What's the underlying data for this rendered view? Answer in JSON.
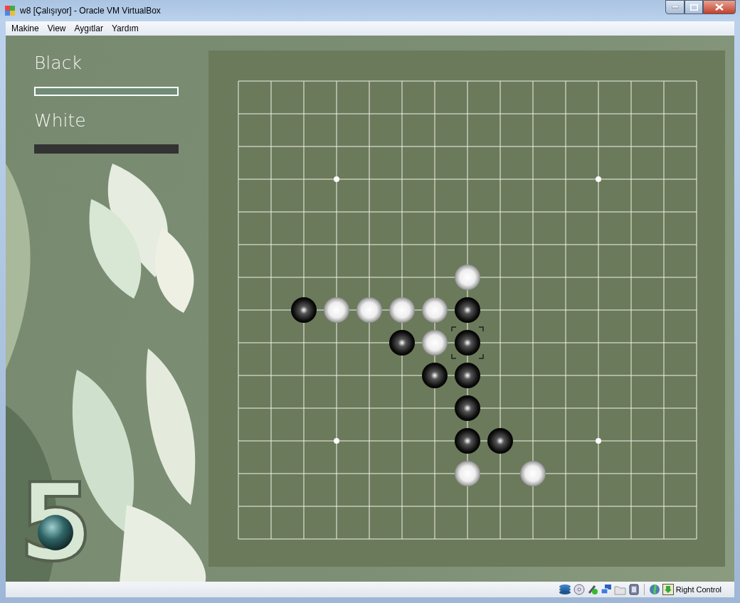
{
  "window": {
    "title": "w8 [Çalışıyor] - Oracle VM VirtualBox"
  },
  "menu": [
    "Makine",
    "View",
    "Aygıtlar",
    "Yardım"
  ],
  "players": [
    {
      "name": "Black",
      "selected": true
    },
    {
      "name": "White",
      "selected": false
    }
  ],
  "logo": "5",
  "board": {
    "rows": [
      {
        "cells": [
          {
            "kind": "empty"
          },
          {
            "kind": "empty"
          },
          {
            "kind": "empty"
          },
          {
            "kind": "empty"
          },
          {
            "kind": "empty"
          },
          {
            "kind": "empty"
          },
          {
            "kind": "empty"
          },
          {
            "kind": "empty"
          },
          {
            "kind": "empty"
          },
          {
            "kind": "empty"
          },
          {
            "kind": "empty"
          },
          {
            "kind": "empty"
          },
          {
            "kind": "empty"
          },
          {
            "kind": "empty"
          },
          {
            "kind": "empty"
          }
        ]
      },
      {
        "cells": [
          {
            "kind": "empty"
          },
          {
            "kind": "empty"
          },
          {
            "kind": "empty"
          },
          {
            "kind": "empty"
          },
          {
            "kind": "empty"
          },
          {
            "kind": "empty"
          },
          {
            "kind": "empty"
          },
          {
            "kind": "empty"
          },
          {
            "kind": "empty"
          },
          {
            "kind": "empty"
          },
          {
            "kind": "empty"
          },
          {
            "kind": "empty"
          },
          {
            "kind": "empty"
          },
          {
            "kind": "empty"
          },
          {
            "kind": "empty"
          }
        ]
      },
      {
        "cells": [
          {
            "kind": "empty"
          },
          {
            "kind": "empty"
          },
          {
            "kind": "empty"
          },
          {
            "kind": "empty"
          },
          {
            "kind": "empty"
          },
          {
            "kind": "empty"
          },
          {
            "kind": "empty"
          },
          {
            "kind": "empty"
          },
          {
            "kind": "empty"
          },
          {
            "kind": "empty"
          },
          {
            "kind": "empty"
          },
          {
            "kind": "empty"
          },
          {
            "kind": "empty"
          },
          {
            "kind": "empty"
          },
          {
            "kind": "empty"
          }
        ]
      },
      {
        "cells": [
          {
            "kind": "empty"
          },
          {
            "kind": "empty"
          },
          {
            "kind": "empty"
          },
          {
            "kind": "empty"
          },
          {
            "kind": "empty"
          },
          {
            "kind": "empty"
          },
          {
            "kind": "empty"
          },
          {
            "kind": "empty"
          },
          {
            "kind": "empty"
          },
          {
            "kind": "empty"
          },
          {
            "kind": "empty"
          },
          {
            "kind": "empty"
          },
          {
            "kind": "empty"
          },
          {
            "kind": "empty"
          },
          {
            "kind": "empty"
          }
        ]
      },
      {
        "cells": [
          {
            "kind": "empty"
          },
          {
            "kind": "empty"
          },
          {
            "kind": "empty"
          },
          {
            "kind": "empty"
          },
          {
            "kind": "empty"
          },
          {
            "kind": "empty"
          },
          {
            "kind": "empty"
          },
          {
            "kind": "empty"
          },
          {
            "kind": "empty"
          },
          {
            "kind": "empty"
          },
          {
            "kind": "empty"
          },
          {
            "kind": "empty"
          },
          {
            "kind": "empty"
          },
          {
            "kind": "empty"
          },
          {
            "kind": "empty"
          }
        ]
      },
      {
        "cells": [
          {
            "kind": "empty"
          },
          {
            "kind": "empty"
          },
          {
            "kind": "empty"
          },
          {
            "kind": "empty"
          },
          {
            "kind": "empty"
          },
          {
            "kind": "empty"
          },
          {
            "kind": "empty"
          },
          {
            "kind": "empty"
          },
          {
            "kind": "empty"
          },
          {
            "kind": "empty"
          },
          {
            "kind": "empty"
          },
          {
            "kind": "empty"
          },
          {
            "kind": "empty"
          },
          {
            "kind": "empty"
          },
          {
            "kind": "empty"
          }
        ]
      },
      {
        "cells": [
          {
            "kind": "empty"
          },
          {
            "kind": "empty"
          },
          {
            "kind": "empty"
          },
          {
            "kind": "empty"
          },
          {
            "kind": "empty"
          },
          {
            "kind": "empty"
          },
          {
            "kind": "empty"
          },
          {
            "kind": "white",
            "marked": false
          },
          {
            "kind": "empty"
          },
          {
            "kind": "empty"
          },
          {
            "kind": "empty"
          },
          {
            "kind": "empty"
          },
          {
            "kind": "empty"
          },
          {
            "kind": "empty"
          },
          {
            "kind": "empty"
          }
        ]
      },
      {
        "cells": [
          {
            "kind": "empty"
          },
          {
            "kind": "empty"
          },
          {
            "kind": "black",
            "marked": false
          },
          {
            "kind": "white",
            "marked": false
          },
          {
            "kind": "white",
            "marked": false
          },
          {
            "kind": "white",
            "marked": false
          },
          {
            "kind": "white",
            "marked": false
          },
          {
            "kind": "black",
            "marked": false
          },
          {
            "kind": "empty"
          },
          {
            "kind": "empty"
          },
          {
            "kind": "empty"
          },
          {
            "kind": "empty"
          },
          {
            "kind": "empty"
          },
          {
            "kind": "empty"
          },
          {
            "kind": "empty"
          }
        ]
      },
      {
        "cells": [
          {
            "kind": "empty"
          },
          {
            "kind": "empty"
          },
          {
            "kind": "empty"
          },
          {
            "kind": "empty"
          },
          {
            "kind": "empty"
          },
          {
            "kind": "black",
            "marked": false
          },
          {
            "kind": "white",
            "marked": false
          },
          {
            "kind": "black",
            "marked": true
          },
          {
            "kind": "empty"
          },
          {
            "kind": "empty"
          },
          {
            "kind": "empty"
          },
          {
            "kind": "empty"
          },
          {
            "kind": "empty"
          },
          {
            "kind": "empty"
          },
          {
            "kind": "empty"
          }
        ]
      },
      {
        "cells": [
          {
            "kind": "empty"
          },
          {
            "kind": "empty"
          },
          {
            "kind": "empty"
          },
          {
            "kind": "empty"
          },
          {
            "kind": "empty"
          },
          {
            "kind": "empty"
          },
          {
            "kind": "black",
            "marked": false
          },
          {
            "kind": "black",
            "marked": false
          },
          {
            "kind": "empty"
          },
          {
            "kind": "empty"
          },
          {
            "kind": "empty"
          },
          {
            "kind": "empty"
          },
          {
            "kind": "empty"
          },
          {
            "kind": "empty"
          },
          {
            "kind": "empty"
          }
        ]
      },
      {
        "cells": [
          {
            "kind": "empty"
          },
          {
            "kind": "empty"
          },
          {
            "kind": "empty"
          },
          {
            "kind": "empty"
          },
          {
            "kind": "empty"
          },
          {
            "kind": "empty"
          },
          {
            "kind": "empty"
          },
          {
            "kind": "black",
            "marked": false
          },
          {
            "kind": "empty"
          },
          {
            "kind": "empty"
          },
          {
            "kind": "empty"
          },
          {
            "kind": "empty"
          },
          {
            "kind": "empty"
          },
          {
            "kind": "empty"
          },
          {
            "kind": "empty"
          }
        ]
      },
      {
        "cells": [
          {
            "kind": "empty"
          },
          {
            "kind": "empty"
          },
          {
            "kind": "empty"
          },
          {
            "kind": "empty"
          },
          {
            "kind": "empty"
          },
          {
            "kind": "empty"
          },
          {
            "kind": "empty"
          },
          {
            "kind": "black",
            "marked": false
          },
          {
            "kind": "black",
            "marked": false
          },
          {
            "kind": "empty"
          },
          {
            "kind": "empty"
          },
          {
            "kind": "empty"
          },
          {
            "kind": "empty"
          },
          {
            "kind": "empty"
          },
          {
            "kind": "empty"
          }
        ]
      },
      {
        "cells": [
          {
            "kind": "empty"
          },
          {
            "kind": "empty"
          },
          {
            "kind": "empty"
          },
          {
            "kind": "empty"
          },
          {
            "kind": "empty"
          },
          {
            "kind": "empty"
          },
          {
            "kind": "empty"
          },
          {
            "kind": "white",
            "marked": false
          },
          {
            "kind": "empty"
          },
          {
            "kind": "white",
            "marked": false
          },
          {
            "kind": "empty"
          },
          {
            "kind": "empty"
          },
          {
            "kind": "empty"
          },
          {
            "kind": "empty"
          },
          {
            "kind": "empty"
          }
        ]
      },
      {
        "cells": [
          {
            "kind": "empty"
          },
          {
            "kind": "empty"
          },
          {
            "kind": "empty"
          },
          {
            "kind": "empty"
          },
          {
            "kind": "empty"
          },
          {
            "kind": "empty"
          },
          {
            "kind": "empty"
          },
          {
            "kind": "empty"
          },
          {
            "kind": "empty"
          },
          {
            "kind": "empty"
          },
          {
            "kind": "empty"
          },
          {
            "kind": "empty"
          },
          {
            "kind": "empty"
          },
          {
            "kind": "empty"
          },
          {
            "kind": "empty"
          }
        ]
      },
      {
        "cells": [
          {
            "kind": "empty"
          },
          {
            "kind": "empty"
          },
          {
            "kind": "empty"
          },
          {
            "kind": "empty"
          },
          {
            "kind": "empty"
          },
          {
            "kind": "empty"
          },
          {
            "kind": "empty"
          },
          {
            "kind": "empty"
          },
          {
            "kind": "empty"
          },
          {
            "kind": "empty"
          },
          {
            "kind": "empty"
          },
          {
            "kind": "empty"
          },
          {
            "kind": "empty"
          },
          {
            "kind": "empty"
          },
          {
            "kind": "empty"
          }
        ]
      }
    ]
  },
  "status_bar": {
    "host_key": "Right Control"
  }
}
